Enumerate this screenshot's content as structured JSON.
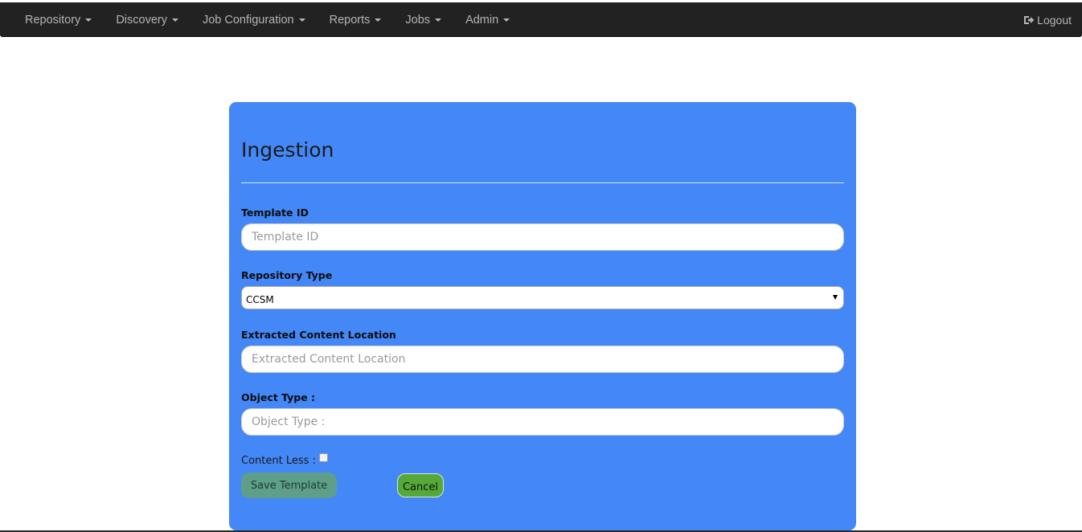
{
  "navbar": {
    "menus": [
      {
        "label": "Repository"
      },
      {
        "label": "Discovery"
      },
      {
        "label": "Job Configuration"
      },
      {
        "label": "Reports"
      },
      {
        "label": "Jobs"
      },
      {
        "label": "Admin"
      }
    ],
    "logout_label": "Logout",
    "logout_icon": "sign-out-icon"
  },
  "form": {
    "title": "Ingestion",
    "template_id": {
      "label": "Template ID",
      "placeholder": "Template ID",
      "value": ""
    },
    "repository_type": {
      "label": "Repository Type",
      "selected": "CCSM"
    },
    "extracted_content_location": {
      "label": "Extracted Content Location",
      "placeholder": "Extracted Content Location",
      "value": ""
    },
    "object_type": {
      "label": "Object Type :",
      "placeholder": "Object Type :",
      "value": ""
    },
    "content_less": {
      "label": "Content Less :",
      "checked": false
    },
    "save_label": "Save Template",
    "cancel_label": "Cancel"
  },
  "colors": {
    "navbar_bg": "#222222",
    "panel_bg": "#4487f6",
    "save_button": "#5f9f89",
    "cancel_button": "#55a83a"
  }
}
